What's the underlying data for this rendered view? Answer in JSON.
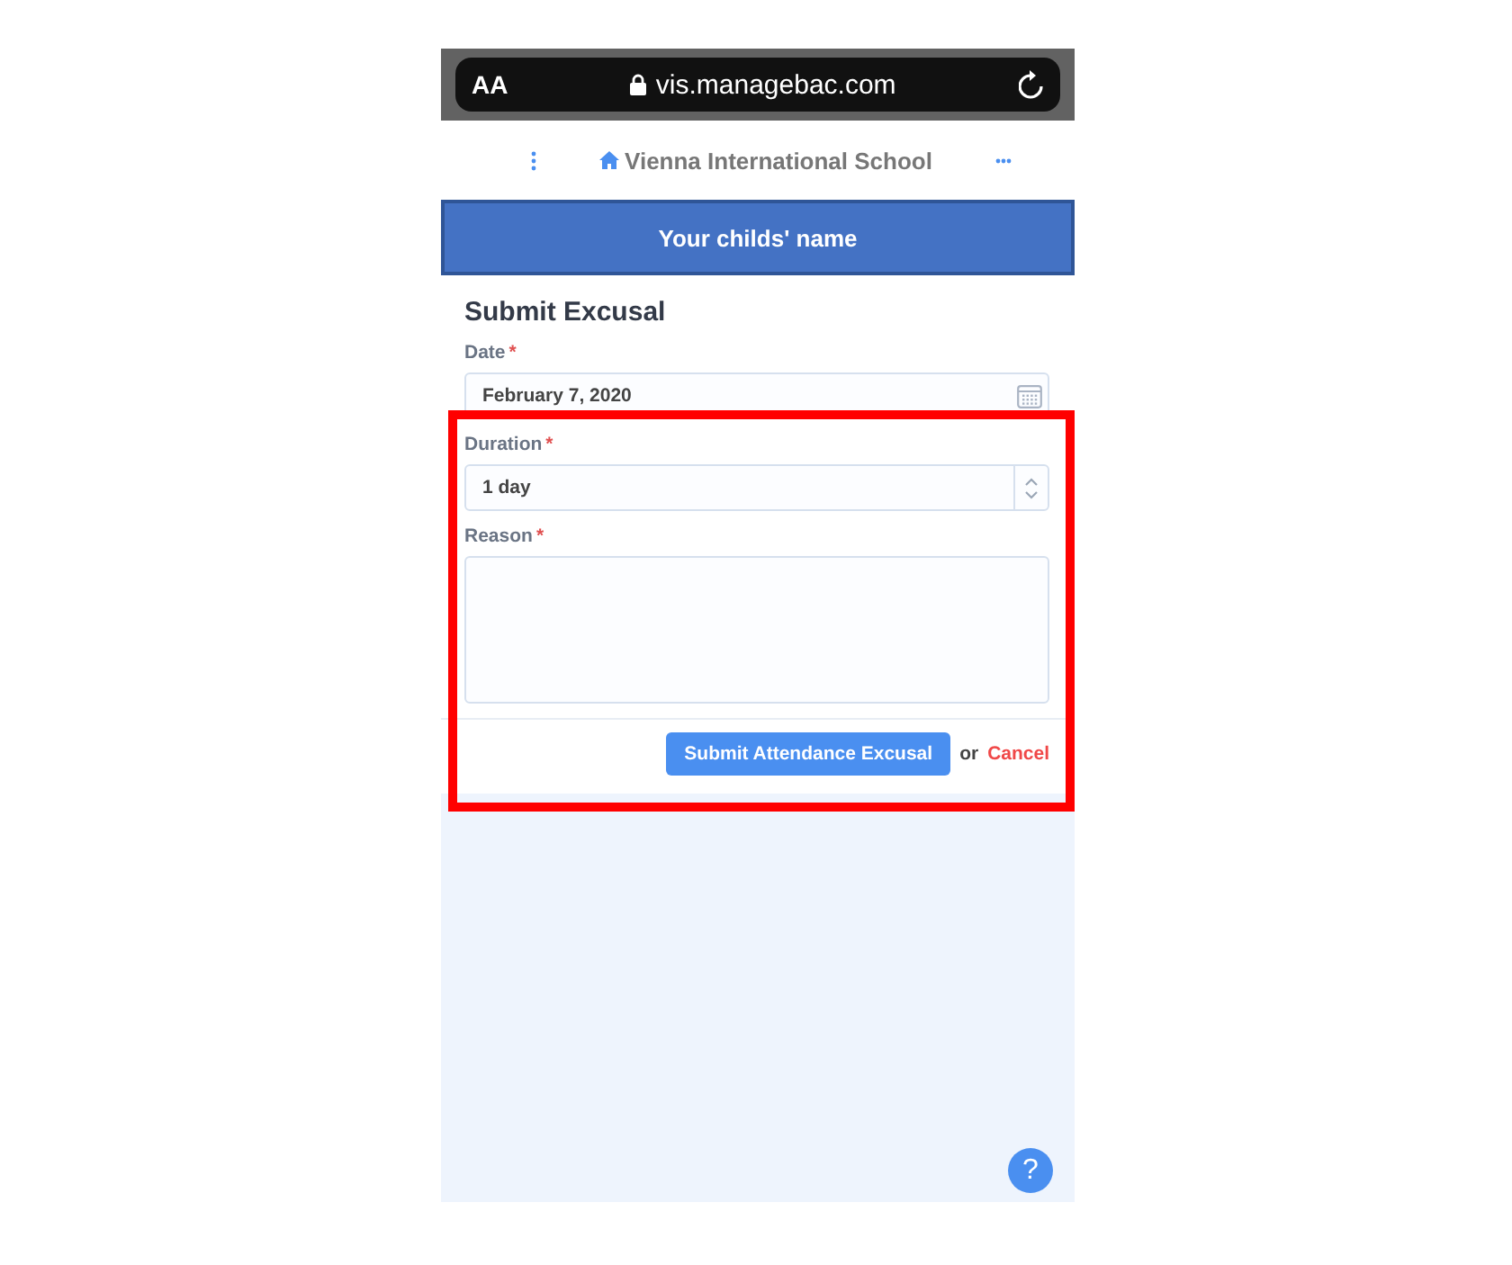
{
  "browser": {
    "text_size": "AA",
    "url": "vis.managebac.com"
  },
  "nav": {
    "title": "Vienna International School"
  },
  "banner": {
    "text": "Your childs' name"
  },
  "form": {
    "title": "Submit Excusal",
    "fields": [
      {
        "kind": "date",
        "label": "Date",
        "required_mark": "*",
        "value": "February 7, 2020"
      },
      {
        "kind": "select",
        "label": "Duration",
        "required_mark": "*",
        "value": "1 day"
      },
      {
        "kind": "textarea",
        "label": "Reason",
        "required_mark": "*"
      }
    ],
    "submit": "Submit Attendance Excusal",
    "or": "or",
    "cancel": "Cancel"
  },
  "help": {
    "label": "?"
  }
}
